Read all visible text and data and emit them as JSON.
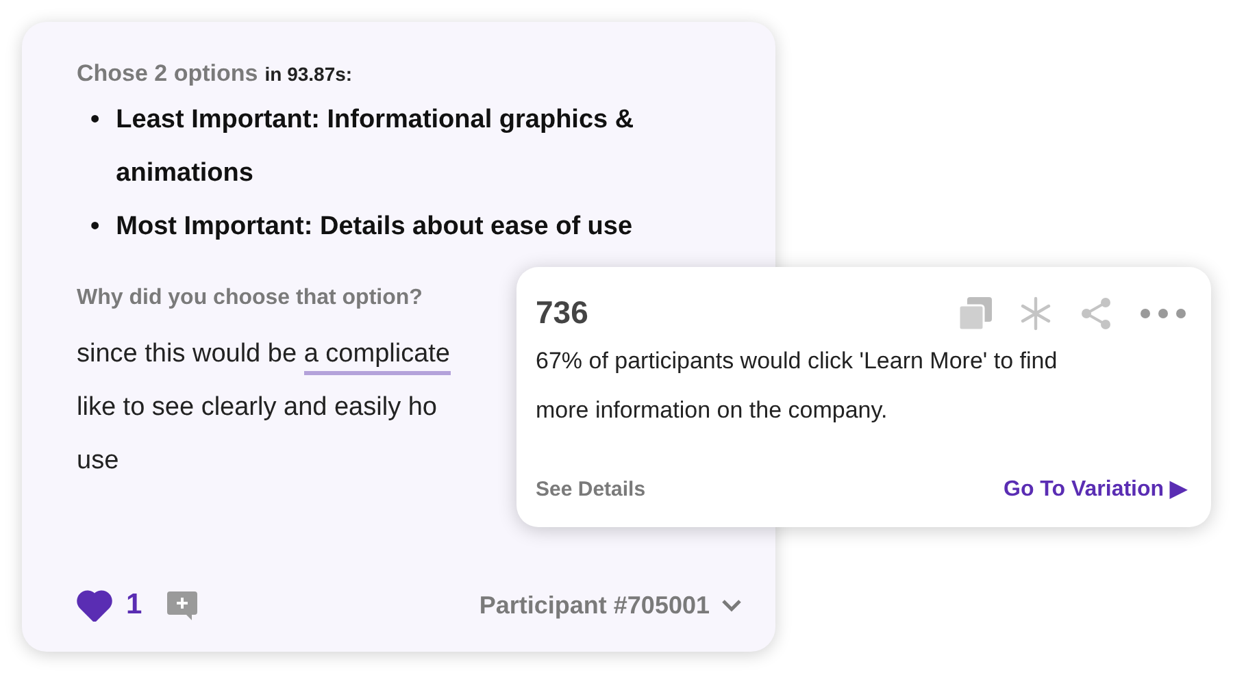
{
  "response_card": {
    "summary": {
      "label": "Chose 2 options",
      "detail": "in 93.87s:"
    },
    "choices": [
      {
        "bullet": "•",
        "text": "Least Important: Informational graphics & animations"
      },
      {
        "bullet": "•",
        "text": "Most Important: Details about ease of use"
      }
    ],
    "question": "Why did you choose that option?",
    "answer_lines": [
      [
        {
          "text": "since this would be ",
          "highlighted": false
        },
        {
          "text": "a complicate",
          "highlighted": true
        }
      ],
      [
        {
          "text": "like to see clearly and easily ho",
          "highlighted": false
        }
      ],
      [
        {
          "text": "use",
          "highlighted": false
        }
      ]
    ],
    "likes": {
      "count": "1",
      "liked": true
    },
    "participant": "Participant #705001"
  },
  "insight_popup": {
    "number": "736",
    "text": "67% of participants would click 'Learn More' to find more information on the company.",
    "details_link": "See Details",
    "variation_link": "Go To Variation ▶"
  }
}
